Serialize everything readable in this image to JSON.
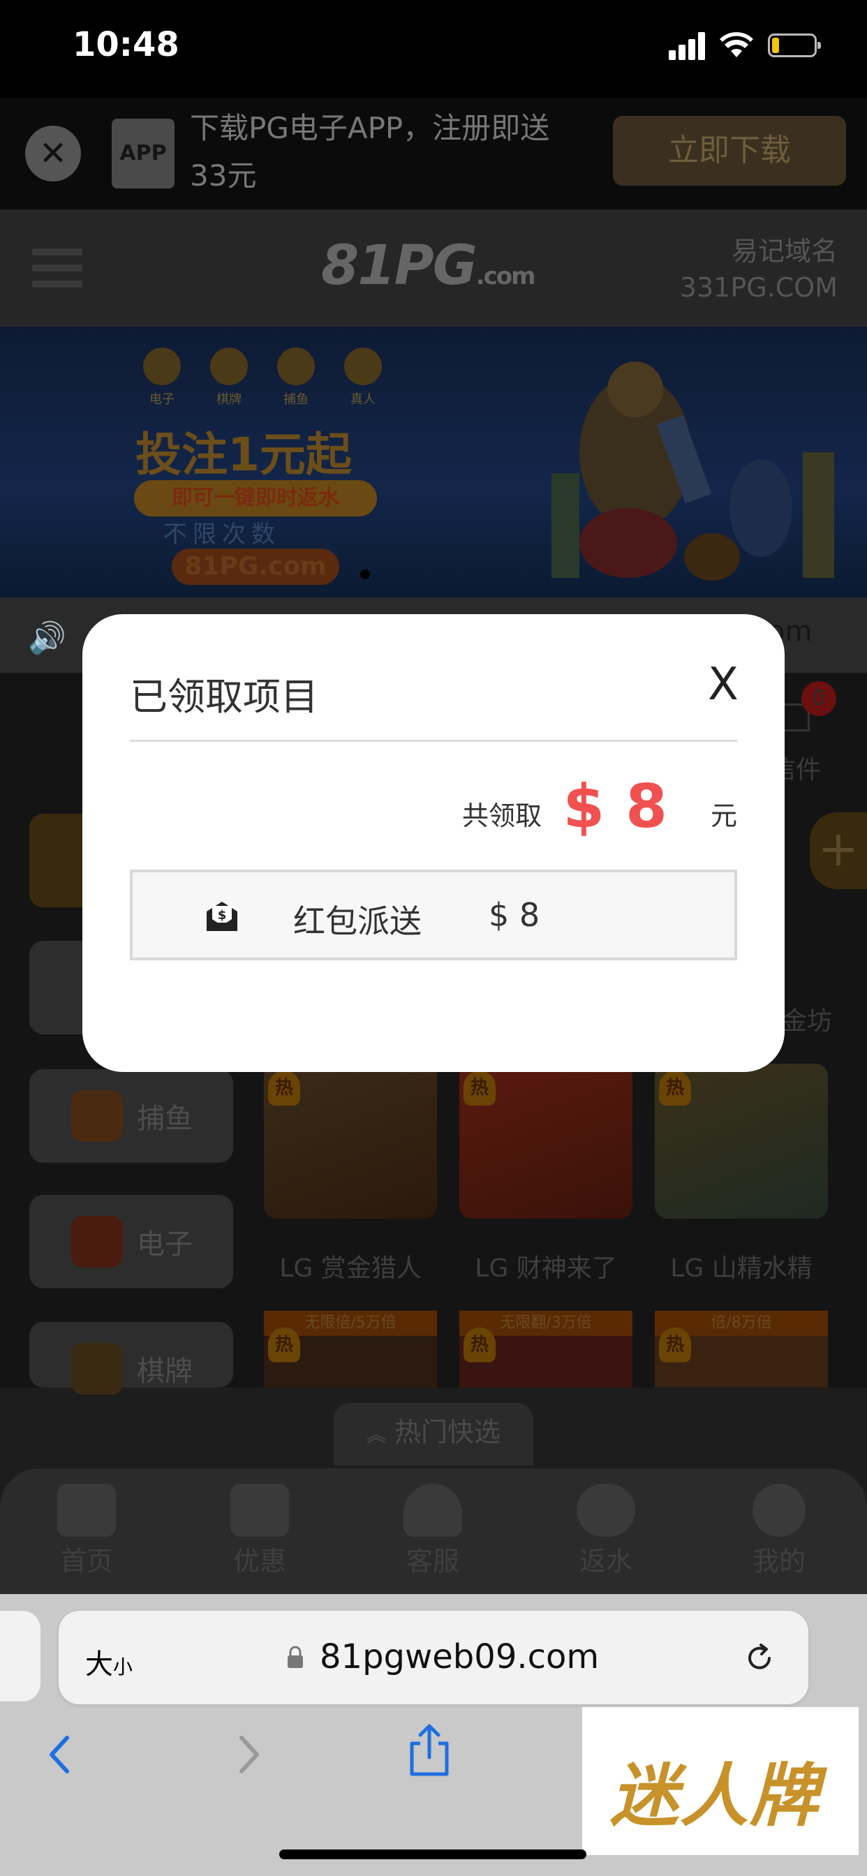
{
  "status_bar": {
    "time": "10:48"
  },
  "download_banner": {
    "app_icon_text": "APP",
    "text": "下载PG电子APP，注册即送33元",
    "button": "立即下载"
  },
  "header": {
    "logo": "81PG",
    "logo_suffix": ".com",
    "domain_hint": "易记域名",
    "domain": "331PG.COM"
  },
  "promo": {
    "categories": [
      "电子",
      "棋牌",
      "捕鱼",
      "真人"
    ],
    "headline": "投注1元起",
    "subline": "即可一键即时返水",
    "ribbon": "不限次数",
    "url": "81PG.com"
  },
  "marquee": {
    "visible_tail": "om"
  },
  "mail": {
    "badge": "0",
    "label": "信件"
  },
  "side_menu": [
    "捕鱼",
    "电子",
    "棋牌"
  ],
  "games": [
    {
      "name": "LG 赏金猎人",
      "hot": "热"
    },
    {
      "name": "LG 财神来了",
      "hot": "热"
    },
    {
      "name": "LG 山精水精",
      "hot": "热"
    }
  ],
  "games_row2": [
    {
      "strip": "无限倍/5万倍",
      "hot": "热"
    },
    {
      "strip": "无限翻/3万倍",
      "hot": "热"
    },
    {
      "strip": "倍/8万倍",
      "hot": "热"
    }
  ],
  "partial_game_label": "金坊",
  "quick_select": "热门快选",
  "bottom_nav": [
    "首页",
    "优惠",
    "客服",
    "返水",
    "我的"
  ],
  "safari": {
    "text_size_big": "大",
    "text_size_small": "小",
    "url": "81pgweb09.com"
  },
  "watermark": "迷人牌",
  "modal": {
    "title": "已领取项目",
    "close": "X",
    "total_label": "共领取",
    "total_amount": "$ 8",
    "total_unit": "元",
    "record_name": "红包派送",
    "record_amount": "$ 8"
  },
  "colors": {
    "accent_red": "#f05050",
    "gold": "#c8922a",
    "overlay": "#000000"
  }
}
